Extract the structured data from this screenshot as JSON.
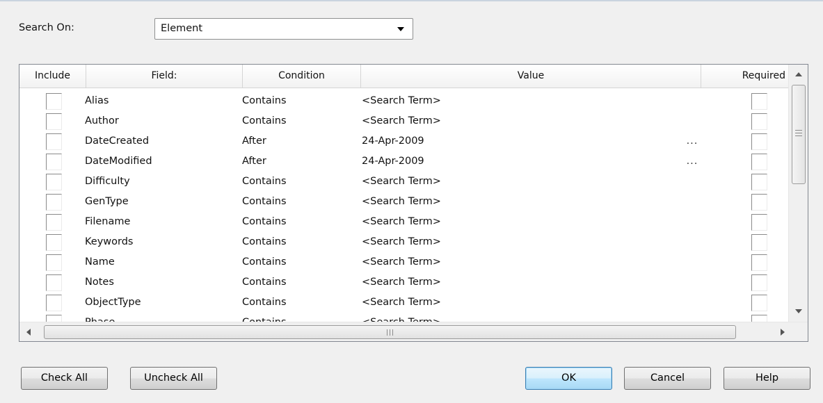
{
  "search": {
    "label": "Search On:",
    "selected": "Element"
  },
  "grid": {
    "columns": [
      "Include",
      "Field:",
      "Condition",
      "Value",
      "Required"
    ],
    "rows": [
      {
        "field": "Alias",
        "condition": "Contains",
        "value": "<Search Term>",
        "ellipsis": ""
      },
      {
        "field": "Author",
        "condition": "Contains",
        "value": "<Search Term>",
        "ellipsis": ""
      },
      {
        "field": "DateCreated",
        "condition": "After",
        "value": "24-Apr-2009",
        "ellipsis": "..."
      },
      {
        "field": "DateModified",
        "condition": "After",
        "value": "24-Apr-2009",
        "ellipsis": "..."
      },
      {
        "field": "Difficulty",
        "condition": "Contains",
        "value": "<Search Term>",
        "ellipsis": ""
      },
      {
        "field": "GenType",
        "condition": "Contains",
        "value": "<Search Term>",
        "ellipsis": ""
      },
      {
        "field": "Filename",
        "condition": "Contains",
        "value": "<Search Term>",
        "ellipsis": ""
      },
      {
        "field": "Keywords",
        "condition": "Contains",
        "value": "<Search Term>",
        "ellipsis": ""
      },
      {
        "field": "Name",
        "condition": "Contains",
        "value": "<Search Term>",
        "ellipsis": ""
      },
      {
        "field": "Notes",
        "condition": "Contains",
        "value": "<Search Term>",
        "ellipsis": ""
      },
      {
        "field": "ObjectType",
        "condition": "Contains",
        "value": "<Search Term>",
        "ellipsis": ""
      },
      {
        "field": "Phase",
        "condition": "Contains",
        "value": "<Search Term>",
        "ellipsis": ""
      }
    ]
  },
  "buttons": {
    "check_all": "Check All",
    "uncheck_all": "Uncheck All",
    "ok": "OK",
    "cancel": "Cancel",
    "help": "Help"
  },
  "icons": {
    "combo_arrow": "chevron-down-icon",
    "scroll_up": "arrow-up-icon",
    "scroll_down": "arrow-down-icon",
    "scroll_left": "arrow-left-icon",
    "scroll_right": "arrow-right-icon"
  },
  "colors": {
    "default_button_border": "#3c7fb1",
    "dialog_background": "#f0f0f0"
  }
}
